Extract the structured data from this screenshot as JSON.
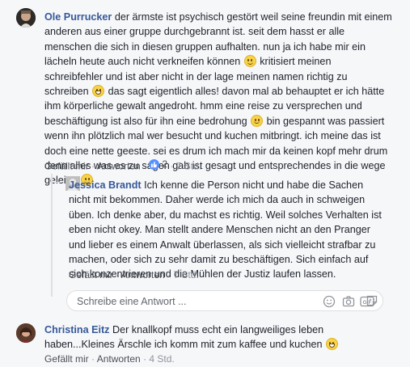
{
  "comments": [
    {
      "author": "Ole Purrucker",
      "segments": [
        "der ärmste ist psychisch gestört weil seine freundin mit einem anderen aus einer gruppe durchgebrannt ist. seit dem hasst er alle menschen die sich in diesen gruppen aufhalten. nun ja ich habe mir ein lächeln heute auch nicht verkneifen können ",
        " kritisiert meinen schreibfehler und ist aber nicht in der lage meinen namen richtig zu schreiben ",
        " das sagt eigentlich alles! davon mal ab behauptet er ich hätte ihm körperliche gewalt angedroht. hmm eine reise zu versprechen und beschäftigung ist also für ihn eine bedrohung ",
        " bin gespannt was passiert wenn ihn plötzlich mal wer besucht und kuchen mitbringt. ich meine das ist doch eine nette geeste. sei es drum ich mach mir da keinen kopf mehr drum denn alles was es zu sagen gab ist gesagt und entsprechendes in die wege geleitet "
      ],
      "actions": {
        "like": "Gefällt mir",
        "reply": "Antworten",
        "like_count": "2",
        "time": "7 Std."
      }
    },
    {
      "author": "Jessica Brandt",
      "text": "Ich kenne die Person nicht und habe die Sachen nicht mit bekommen. Daher werde ich mich da auch in schweigen üben. Ich denke aber, du machst es richtig. Weil solches Verhalten ist eben nicht okey. Man stellt andere Menschen nicht an den Pranger und lieber es einem Anwalt überlassen, als sich vielleicht strafbar zu machen, oder sich zu sehr damit zu beschäftigen. Sich einfach auf sich konzentrieren und die Mühlen der Justiz laufen lassen.",
      "actions": {
        "like": "Gefällt mir",
        "reply": "Antworten",
        "time": "7 Std."
      }
    },
    {
      "author": "Christina Eitz",
      "text": "Der knallkopf muss echt ein langweiliges leben haben...Kleines Ärschle ich komm mit zum kaffee und kuchen ",
      "actions": {
        "like": "Gefällt mir",
        "reply": "Antworten",
        "time": "4 Std."
      }
    }
  ],
  "reply_box": {
    "placeholder": "Schreibe eine Antwort ..."
  },
  "separator": "·"
}
